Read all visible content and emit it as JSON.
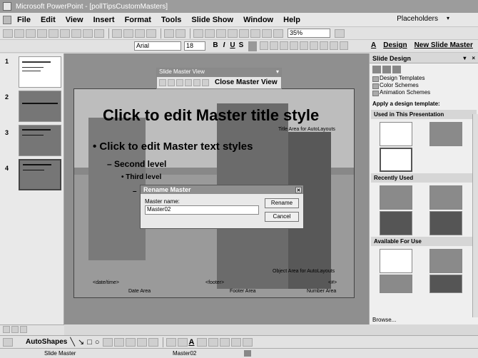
{
  "window": {
    "title": "Microsoft PowerPoint - [pollTipsCustomMasters]"
  },
  "menu": {
    "items": [
      "File",
      "Edit",
      "View",
      "Insert",
      "Format",
      "Tools",
      "Slide Show",
      "Window",
      "Help"
    ],
    "placeholders": "Placeholders"
  },
  "toolbar": {
    "zoom": "35%",
    "font": "Arial",
    "font_size": "18",
    "bold": "B",
    "italic": "I",
    "underline": "U",
    "shadow": "S",
    "design_label": "Design",
    "new_slide_label": "New Slide Master"
  },
  "slides": {
    "numbers": [
      "1",
      "2",
      "3",
      "4"
    ]
  },
  "slide_master_view": {
    "title": "Slide Master View",
    "close_label": "Close Master View"
  },
  "slide": {
    "title": "Click to edit Master title style",
    "title_area": "Title Area for AutoLayouts",
    "bullet1": "• Click to edit Master text styles",
    "bullet2": "– Second level",
    "bullet3": "• Third level",
    "bullet4": "–",
    "object_area": "Object Area for AutoLayouts",
    "date_field": "<date/time>",
    "footer_field": "<footer>",
    "number_field": "<#>",
    "date_label": "Date Area",
    "footer_label": "Footer Area",
    "number_label": "Number Area"
  },
  "dialog": {
    "title": "Rename Master",
    "label": "Master name:",
    "value": "Master02",
    "rename_label": "Rename",
    "cancel_label": "Cancel"
  },
  "taskpane": {
    "title": "Slide Design",
    "links": [
      "Design Templates",
      "Color Schemes",
      "Animation Schemes"
    ],
    "apply_label": "Apply a design template:",
    "sections": [
      "Used in This Presentation",
      "Recently Used",
      "Available For Use"
    ],
    "browse_label": "Browse..."
  },
  "drawbar": {
    "autoshapes_label": "AutoShapes"
  },
  "status": {
    "view": "Slide Master",
    "master": "Master02"
  }
}
